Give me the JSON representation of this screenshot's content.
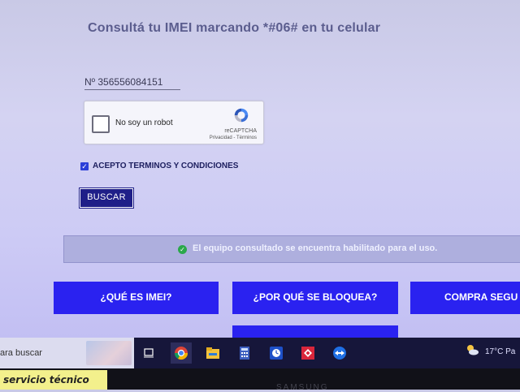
{
  "header": {
    "title": "Consultá tu IMEI marcando *#06# en tu celular"
  },
  "form": {
    "imei_value": "Nº 356556084151",
    "captcha": {
      "label": "No soy un robot",
      "brand": "reCAPTCHA",
      "links": "Privacidad - Términos"
    },
    "terms_checkbox_mark": "✓",
    "terms_label": "ACEPTO TERMINOS Y CONDICIONES",
    "search_button": "BUSCAR"
  },
  "status": {
    "icon_mark": "✓",
    "message": "El equipo consultado se encuentra habilitado para el uso.",
    "color": "#2ba84a"
  },
  "nav_buttons": [
    {
      "label": "¿QUÉ ES IMEI?"
    },
    {
      "label": "¿POR QUÉ SE BLOQUEA?"
    },
    {
      "label": "COMPRA SEGU"
    },
    {
      "label": ""
    }
  ],
  "taskbar": {
    "search_text": "ara buscar",
    "icons": [
      "task-view-icon",
      "chrome-icon",
      "file-explorer-icon",
      "calculator-icon",
      "clock-app-icon",
      "anydesk-icon",
      "teamviewer-icon"
    ],
    "weather_icon": "weather-cloud-sun-icon",
    "temperature": "17°C  Pa"
  },
  "sticker": {
    "text": "servicio técnico"
  },
  "monitor_brand": "SAMSUNG"
}
